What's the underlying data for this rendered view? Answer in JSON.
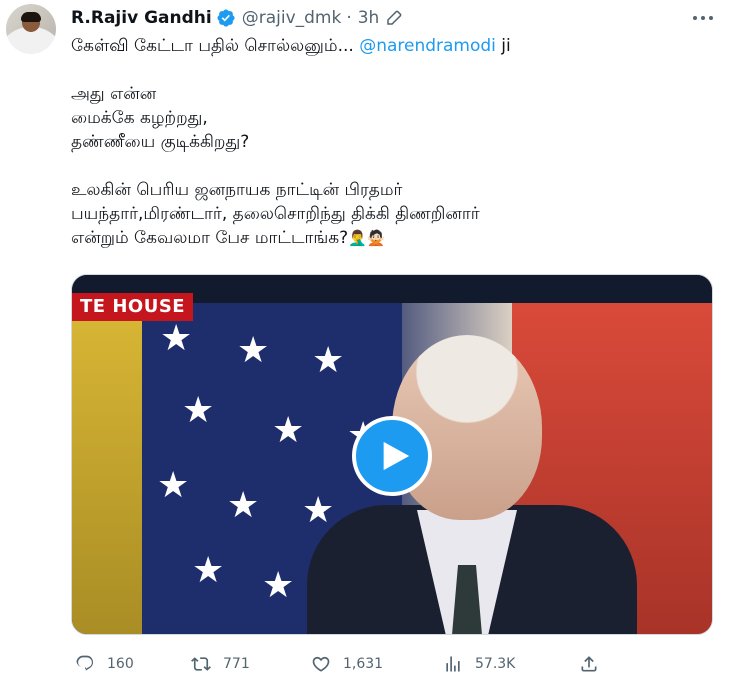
{
  "author": {
    "name": "R.Rajiv Gandhi",
    "handle": "@rajiv_dmk",
    "separator": "·",
    "time": "3h"
  },
  "tweet": {
    "line1_text": "கேள்வி கேட்டா பதில் சொல்லனும்... ",
    "line1_mention": "@narendramodi",
    "line1_suffix": " ji",
    "line2": "அது என்ன",
    "line3": "மைக்கே கழற்றது,",
    "line4": "தண்ணீயை குடிக்கிறது?",
    "line5": "உலகின் பெரிய ஜனநாயக நாட்டின் பிரதமர்",
    "line6": "பயந்தார்,மிரண்டார், தலைசொறிந்து திக்கி திணறினார்",
    "line7_text": "என்றும் கேவலமா பேச மாட்டாங்க?",
    "line7_emoji": "🤦‍♂️🙅🏻"
  },
  "media": {
    "chyron": "TE HOUSE"
  },
  "actions": {
    "replies": "160",
    "retweets": "771",
    "likes": "1,631",
    "views": "57.3K"
  },
  "colors": {
    "accent": "#1d9bf0",
    "text": "#0f1419",
    "secondary": "#536471"
  },
  "icons": {
    "verified": "verified-badge-icon",
    "edit": "edit-pencil-icon",
    "more": "more-dots-icon",
    "play": "play-icon",
    "reply": "reply-icon",
    "retweet": "retweet-icon",
    "like": "heart-icon",
    "views": "views-chart-icon",
    "share": "share-icon"
  }
}
